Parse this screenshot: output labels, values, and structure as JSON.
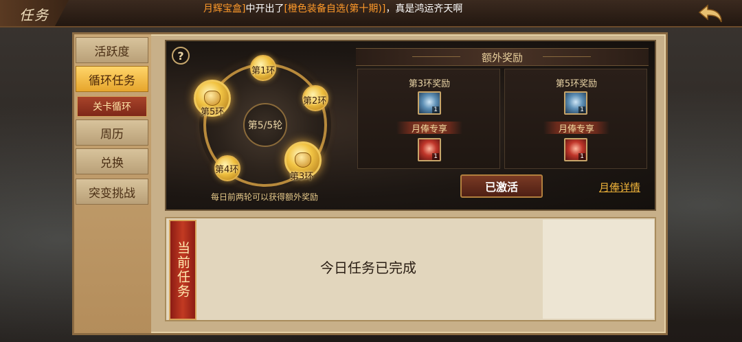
{
  "header": {
    "title": "任务",
    "marquee_prefix": "月辉宝盒]",
    "marquee_mid": "中开出了",
    "marquee_item": "[橙色装备自选(第十期)]",
    "marquee_suffix": "，真是鸿运齐天啊",
    "back_icon": "back-arrow-icon"
  },
  "nav": {
    "items": [
      {
        "label": "活跃度"
      },
      {
        "label": "循环任务"
      },
      {
        "label": "关卡循环"
      },
      {
        "label": "周历"
      },
      {
        "label": "兑换"
      },
      {
        "label": "突变挑战"
      }
    ]
  },
  "wheel": {
    "help": "?",
    "center": "第5/5轮",
    "rings": [
      "第1环",
      "第2环",
      "第3环",
      "第4环",
      "第5环"
    ],
    "tip": "每日前两轮可以获得额外奖励"
  },
  "extra": {
    "title": "额外奖励",
    "boxes": [
      {
        "title": "第3环奖励",
        "item_count": "1",
        "monthly": "月俸专享",
        "monthly_count": "1"
      },
      {
        "title": "第5环奖励",
        "item_count": "1",
        "monthly": "月俸专享",
        "monthly_count": "1"
      }
    ],
    "activated": "已激活",
    "details_link": "月俸详情"
  },
  "current": {
    "tag": "当前任务",
    "status": "今日任务已完成"
  },
  "colors": {
    "accent_gold": "#e6a52c",
    "link_orange": "#f0b43a",
    "tag_red": "#c23a22"
  }
}
